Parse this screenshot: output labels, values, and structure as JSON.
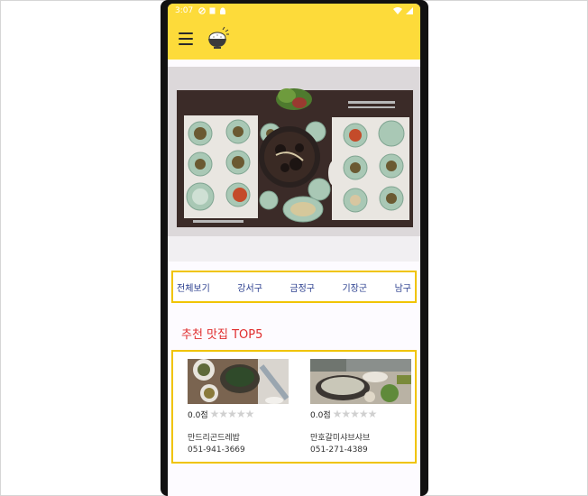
{
  "status_bar": {
    "time": "3:07"
  },
  "app_bar": {
    "menu_icon": "hamburger-menu-icon",
    "logo_icon": "rice-bowl-logo-icon",
    "accent_color": "#fddb3a"
  },
  "hero": {
    "icon": "korean-table-photo"
  },
  "tabs": [
    "전체보기",
    "강서구",
    "금정구",
    "기장군",
    "남구"
  ],
  "section": {
    "title": "추천 맛집 TOP5",
    "title_color": "#e02d2d"
  },
  "restaurants": [
    {
      "score": "0.0점",
      "stars": "★★★★★",
      "name": "만드리곤드레밥",
      "phone": "051-941-3669"
    },
    {
      "score": "0.0점",
      "stars": "★★★★★",
      "name": "만호갈미샤브샤브",
      "phone": "051-271-4389"
    }
  ]
}
